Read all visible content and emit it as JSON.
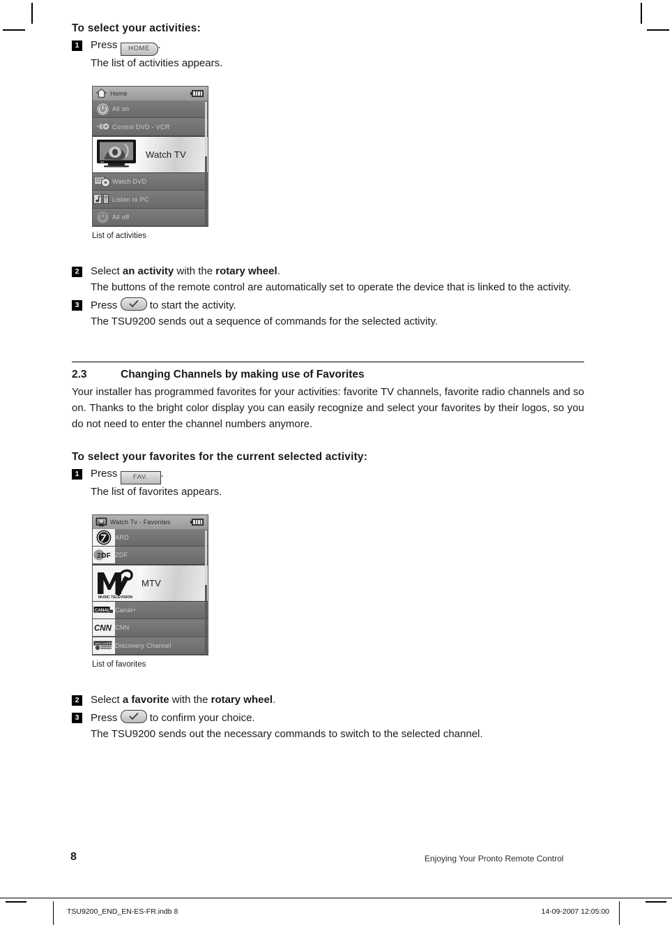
{
  "page": {
    "folio": "8",
    "running_head": "Enjoying Your Pronto Remote Control"
  },
  "slug": {
    "file": "TSU9200_END_EN-ES-FR.indb   8",
    "stamp": "14-09-2007   12:05:00"
  },
  "section_activities": {
    "heading": "To select your activities:",
    "step1": {
      "num": "1",
      "press_label": "Press",
      "key": "HOME",
      "period": ".",
      "result": "The list of activities appears."
    },
    "step2": {
      "num": "2",
      "lead": "Select",
      "bold1": "an activity",
      "mid": "with the",
      "bold2": "rotary wheel",
      "end": ".",
      "result": "The buttons of the remote control are automatically set to operate the device that is linked to the activity."
    },
    "step3": {
      "num": "3",
      "press_label": "Press",
      "key_icon": "checkmark-icon",
      "after": "to start the activity.",
      "result": "The TSU9200 sends out a sequence of commands for the selected activity."
    }
  },
  "screen_activities": {
    "caption": "List of activities",
    "title": "Home",
    "title_icon": "home-icon",
    "battery_icon": "battery-full-icon",
    "rows": [
      {
        "label": "All on",
        "icon": "power-on-icon",
        "selected": false
      },
      {
        "label": "Control DVD - VCR",
        "icon": "dvd-vcr-icon",
        "selected": false
      },
      {
        "label": "Watch TV",
        "icon": "television-icon",
        "selected": true
      },
      {
        "label": "Watch DVD",
        "icon": "dvd-disc-icon",
        "selected": false
      },
      {
        "label": "Listen to PC",
        "icon": "music-pc-icon",
        "selected": false
      },
      {
        "label": "All off",
        "icon": "power-off-icon",
        "selected": false
      }
    ]
  },
  "section_favorites": {
    "number": "2.3",
    "title": "Changing Channels by making use of Favorites",
    "body": "Your installer has programmed favorites for your activities: favorite TV channels, favorite radio channels and so on. Thanks to the bright color display you can easily recognize and select your favorites by their logos, so you do not need to enter the channel numbers anymore.",
    "heading": "To select your favorites for the current selected activity:",
    "step1": {
      "num": "1",
      "press_label": "Press",
      "key": "FAV.",
      "period": ".",
      "result": "The list of favorites appears."
    },
    "step2": {
      "num": "2",
      "lead": "Select",
      "bold1": "a favorite",
      "mid": "with the",
      "bold2": "rotary wheel",
      "end": "."
    },
    "step3": {
      "num": "3",
      "press_label": "Press",
      "key_icon": "checkmark-icon",
      "after": "to confirm your choice.",
      "result": "The TSU9200 sends out the necessary commands to switch to the selected channel."
    }
  },
  "screen_favorites": {
    "caption": "List of favorites",
    "title": "Watch Tv - Favorites",
    "title_icon": "television-icon",
    "battery_icon": "battery-full-icon",
    "rows": [
      {
        "label": "ARD",
        "icon": "ard-logo-icon",
        "selected": false
      },
      {
        "label": "ZDF",
        "icon": "zdf-logo-icon",
        "selected": false
      },
      {
        "label": "MTV",
        "icon": "mtv-logo-icon",
        "selected": true
      },
      {
        "label": "Canal+",
        "icon": "canalplus-logo-icon",
        "selected": false
      },
      {
        "label": "CNN",
        "icon": "cnn-logo-icon",
        "selected": false
      },
      {
        "label": "Discovery Channel",
        "icon": "discovery-logo-icon",
        "selected": false
      }
    ]
  }
}
